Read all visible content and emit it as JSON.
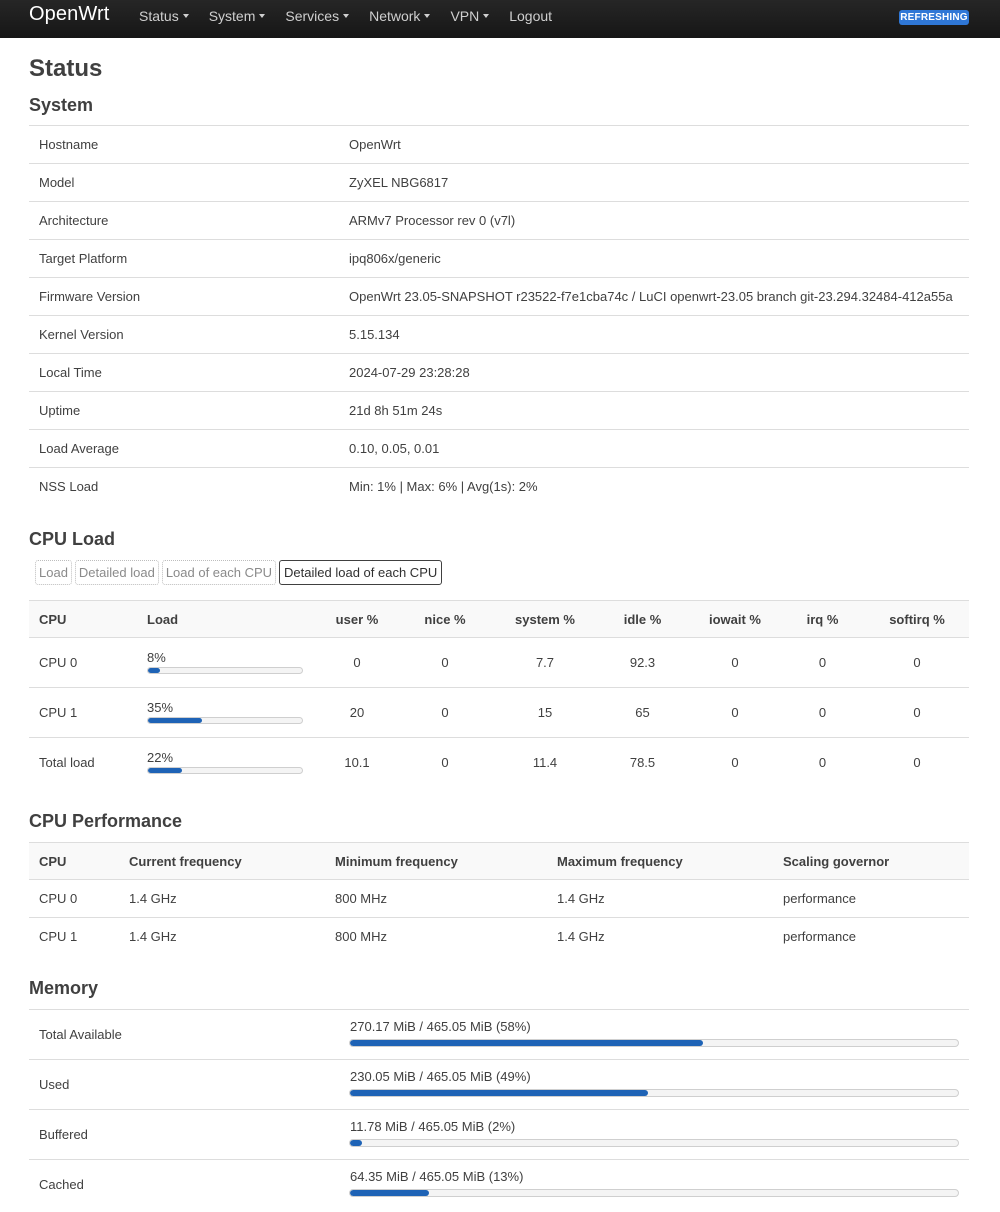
{
  "navbar": {
    "brand": "OpenWrt",
    "items": [
      {
        "label": "Status",
        "dropdown": true
      },
      {
        "label": "System",
        "dropdown": true
      },
      {
        "label": "Services",
        "dropdown": true
      },
      {
        "label": "Network",
        "dropdown": true
      },
      {
        "label": "VPN",
        "dropdown": true
      },
      {
        "label": "Logout",
        "dropdown": false
      }
    ],
    "badge": "REFRESHING",
    "badge_color": "#2f77d6"
  },
  "page_title": "Status",
  "system": {
    "heading": "System",
    "rows": [
      {
        "key": "Hostname",
        "value": "OpenWrt"
      },
      {
        "key": "Model",
        "value": "ZyXEL NBG6817"
      },
      {
        "key": "Architecture",
        "value": "ARMv7 Processor rev 0 (v7l)"
      },
      {
        "key": "Target Platform",
        "value": "ipq806x/generic"
      },
      {
        "key": "Firmware Version",
        "value": "OpenWrt 23.05-SNAPSHOT r23522-f7e1cba74c / LuCI openwrt-23.05 branch git-23.294.32484-412a55a"
      },
      {
        "key": "Kernel Version",
        "value": "5.15.134"
      },
      {
        "key": "Local Time",
        "value": "2024-07-29 23:28:28"
      },
      {
        "key": "Uptime",
        "value": "21d 8h 51m 24s"
      },
      {
        "key": "Load Average",
        "value": "0.10, 0.05, 0.01"
      },
      {
        "key": "NSS Load",
        "value": "Min: 1% | Max: 6% | Avg(1s): 2%"
      }
    ]
  },
  "cpu_load": {
    "heading": "CPU Load",
    "tabs": [
      {
        "label": "Load",
        "active": false
      },
      {
        "label": "Detailed load",
        "active": false
      },
      {
        "label": "Load of each CPU",
        "active": false
      },
      {
        "label": "Detailed load of each CPU",
        "active": true
      }
    ],
    "headers": [
      "CPU",
      "Load",
      "user %",
      "nice %",
      "system %",
      "idle %",
      "iowait %",
      "irq %",
      "softirq %"
    ],
    "rows": [
      {
        "cpu": "CPU 0",
        "load_label": "8%",
        "load_fraction": 0.08,
        "user": "0",
        "nice": "0",
        "system": "7.7",
        "idle": "92.3",
        "iowait": "0",
        "irq": "0",
        "softirq": "0"
      },
      {
        "cpu": "CPU 1",
        "load_label": "35%",
        "load_fraction": 0.35,
        "user": "20",
        "nice": "0",
        "system": "15",
        "idle": "65",
        "iowait": "0",
        "irq": "0",
        "softirq": "0"
      },
      {
        "cpu": "Total load",
        "load_label": "22%",
        "load_fraction": 0.22,
        "user": "10.1",
        "nice": "0",
        "system": "11.4",
        "idle": "78.5",
        "iowait": "0",
        "irq": "0",
        "softirq": "0"
      }
    ],
    "bar_color": "#1e63b6"
  },
  "cpu_performance": {
    "heading": "CPU Performance",
    "headers": [
      "CPU",
      "Current frequency",
      "Minimum frequency",
      "Maximum frequency",
      "Scaling governor"
    ],
    "rows": [
      {
        "cpu": "CPU 0",
        "current": "1.4 GHz",
        "min": "800 MHz",
        "max": "1.4 GHz",
        "governor": "performance"
      },
      {
        "cpu": "CPU 1",
        "current": "1.4 GHz",
        "min": "800 MHz",
        "max": "1.4 GHz",
        "governor": "performance"
      }
    ]
  },
  "memory": {
    "heading": "Memory",
    "rows": [
      {
        "key": "Total Available",
        "text": "270.17 MiB / 465.05 MiB (58%)",
        "fraction": 0.58
      },
      {
        "key": "Used",
        "text": "230.05 MiB / 465.05 MiB (49%)",
        "fraction": 0.49
      },
      {
        "key": "Buffered",
        "text": "11.78 MiB / 465.05 MiB (2%)",
        "fraction": 0.02
      },
      {
        "key": "Cached",
        "text": "64.35 MiB / 465.05 MiB (13%)",
        "fraction": 0.13
      }
    ]
  }
}
